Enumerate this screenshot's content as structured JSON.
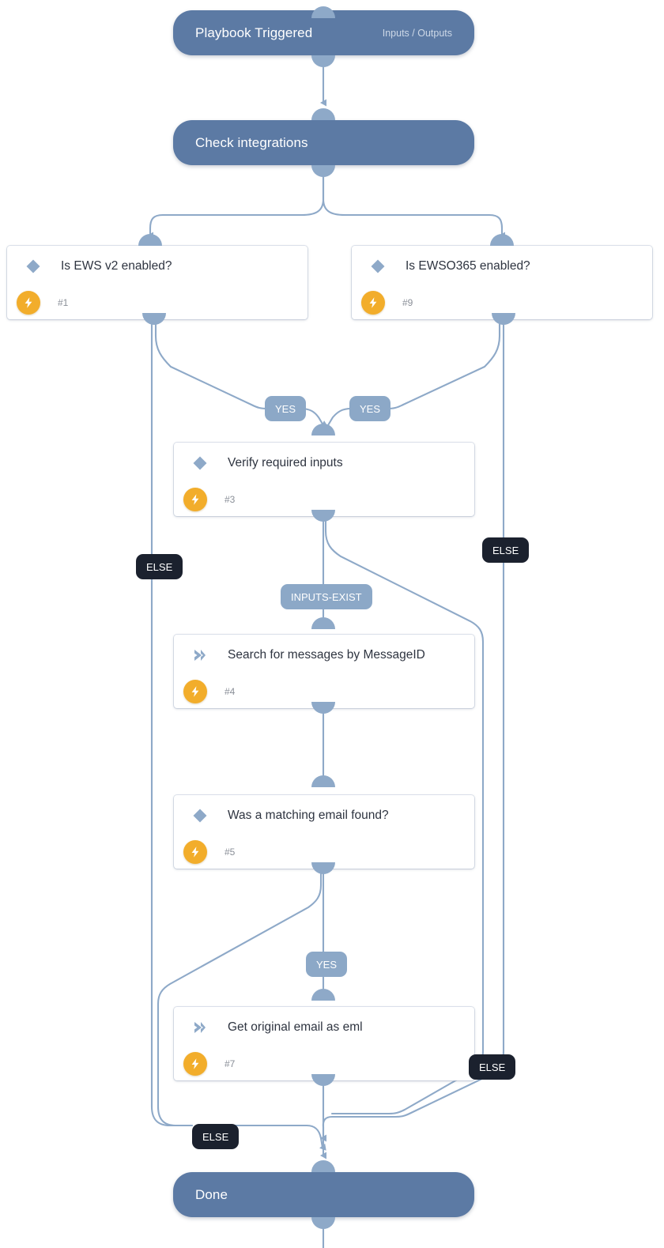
{
  "diagram": {
    "title": "Playbook flow",
    "colors": {
      "terminal": "#5c7aa4",
      "connector": "#8ea9c8",
      "bolt_badge": "#f2ad2b",
      "else_label": "#1b212e",
      "yes_label": "#8ca8c7",
      "card_bg": "#ffffff",
      "canvas_bg": "#ffffff"
    }
  },
  "nodes": {
    "start": {
      "title": "Playbook Triggered",
      "meta": "Inputs / Outputs",
      "type": "terminal"
    },
    "check_integrations": {
      "title": "Check integrations",
      "type": "terminal"
    },
    "ews_v2": {
      "title": "Is EWS v2 enabled?",
      "number": "#1",
      "icon": "condition-diamond-icon",
      "badge": "lightning-bolt-icon"
    },
    "ewso365": {
      "title": "Is EWSO365 enabled?",
      "number": "#9",
      "icon": "condition-diamond-icon",
      "badge": "lightning-bolt-icon"
    },
    "verify_inputs": {
      "title": "Verify required inputs",
      "number": "#3",
      "icon": "condition-diamond-icon",
      "badge": "lightning-bolt-icon"
    },
    "search_messages": {
      "title": "Search for messages by MessageID",
      "number": "#4",
      "icon": "task-chevron-icon",
      "badge": "lightning-bolt-icon"
    },
    "matching_email": {
      "title": "Was a matching email found?",
      "number": "#5",
      "icon": "condition-diamond-icon",
      "badge": "lightning-bolt-icon"
    },
    "get_eml": {
      "title": "Get original email as eml",
      "number": "#7",
      "icon": "task-chevron-icon",
      "badge": "lightning-bolt-icon"
    },
    "done": {
      "title": "Done",
      "type": "terminal"
    }
  },
  "edge_labels": {
    "yes_left": "YES",
    "yes_right": "YES",
    "else_ews_v2": "ELSE",
    "else_ewso365": "ELSE",
    "inputs_exist": "INPUTS-EXIST",
    "yes_matching": "YES",
    "else_matching": "ELSE",
    "else_bottom_left": "ELSE"
  }
}
